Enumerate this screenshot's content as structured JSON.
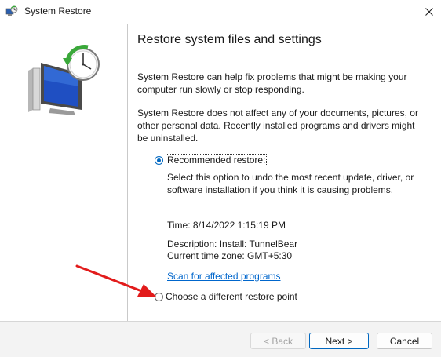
{
  "window": {
    "title": "System Restore",
    "icon": "system-restore-icon"
  },
  "main": {
    "heading": "Restore system files and settings",
    "para1": "System Restore can help fix problems that might be making your computer run slowly or stop responding.",
    "para2": "System Restore does not affect any of your documents, pictures, or other personal data. Recently installed programs and drivers might be uninstalled.",
    "recommended": {
      "label": "Recommended restore:",
      "checked": true,
      "description": "Select this option to undo the most recent update, driver, or software installation if you think it is causing problems."
    },
    "info": {
      "time": "Time: 8/14/2022 1:15:19 PM",
      "description": "Description: Install: TunnelBear",
      "timezone": "Current time zone: GMT+5:30"
    },
    "scan_link": "Scan for affected programs",
    "different": {
      "label": "Choose a different restore point",
      "checked": false
    }
  },
  "footer": {
    "back": "< Back",
    "next": "Next >",
    "cancel": "Cancel"
  },
  "colors": {
    "accent": "#0067c0",
    "link": "#0066cc",
    "arrow": "#e21b1b"
  }
}
